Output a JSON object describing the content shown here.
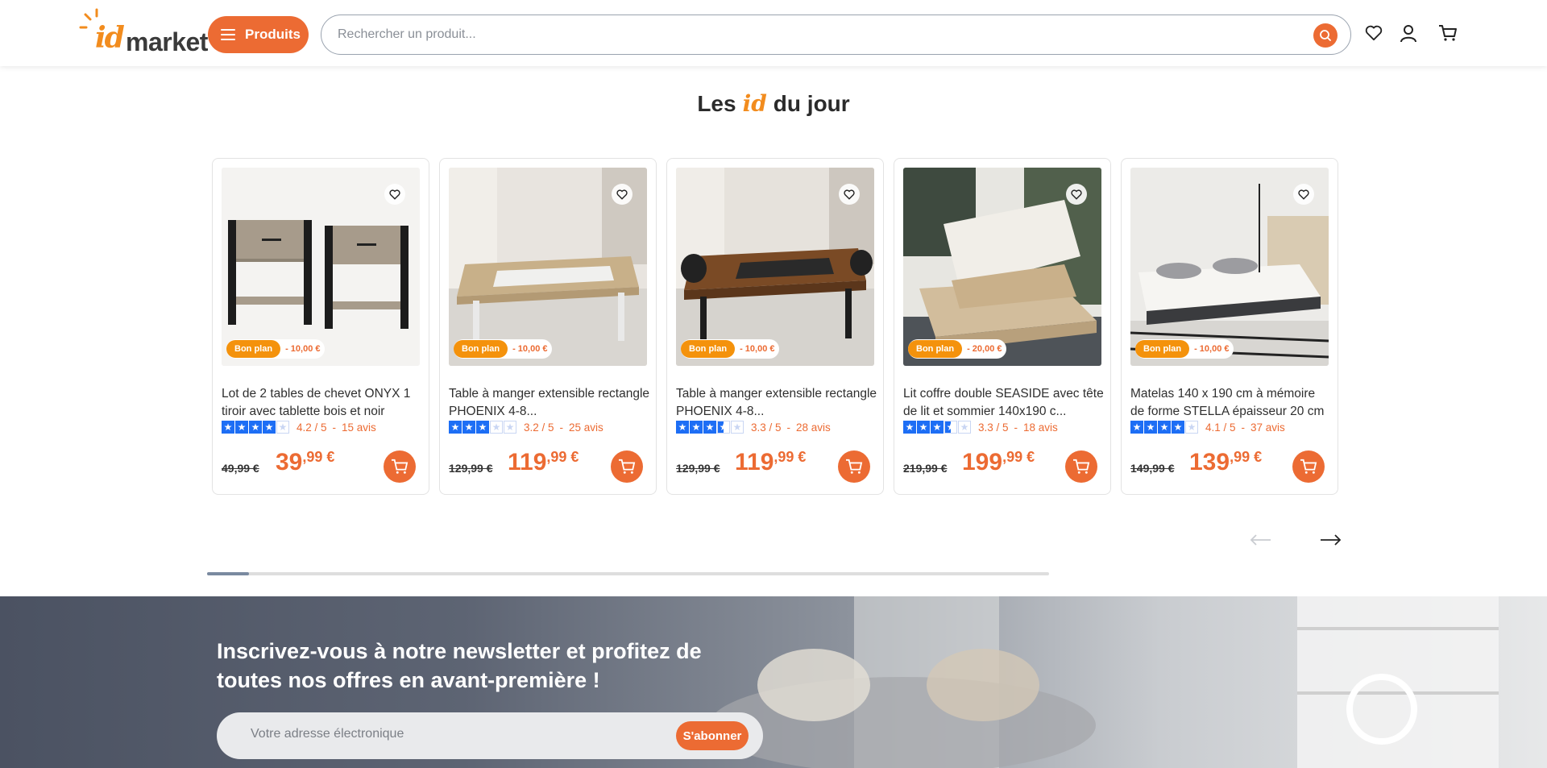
{
  "header": {
    "logo_text": "idmarket",
    "products_button": "Produits",
    "search_placeholder": "Rechercher un produit..."
  },
  "section": {
    "title_left": "Les",
    "title_id": "id",
    "title_right": "du jour"
  },
  "products": [
    {
      "name": "Lot de 2 tables de chevet ONYX 1 tiroir avec tablette bois et noir",
      "badge": "Bon plan",
      "discount": "- 10,00 €",
      "rating": 4.2,
      "rating_text": "4.2 / 5",
      "reviews": "15 avis",
      "old_price": "49,99 €",
      "price_int": "39",
      "price_dec": ",99 €"
    },
    {
      "name": "Table à manger extensible rectangle PHOENIX 4-8...",
      "badge": "Bon plan",
      "discount": "- 10,00 €",
      "rating": 3.2,
      "rating_text": "3.2 / 5",
      "reviews": "25 avis",
      "old_price": "129,99 €",
      "price_int": "119",
      "price_dec": ",99 €"
    },
    {
      "name": "Table à manger extensible rectangle PHOENIX 4-8...",
      "badge": "Bon plan",
      "discount": "- 10,00 €",
      "rating": 3.3,
      "rating_text": "3.3 / 5",
      "reviews": "28 avis",
      "old_price": "129,99 €",
      "price_int": "119",
      "price_dec": ",99 €"
    },
    {
      "name": "Lit coffre double SEASIDE avec tête de lit et sommier 140x190 c...",
      "badge": "Bon plan",
      "discount": "- 20,00 €",
      "rating": 3.3,
      "rating_text": "3.3 / 5",
      "reviews": "18 avis",
      "old_price": "219,99 €",
      "price_int": "199",
      "price_dec": ",99 €"
    },
    {
      "name": "Matelas 140 x 190 cm à mémoire de forme STELLA épaisseur 20 cm",
      "badge": "Bon plan",
      "discount": "- 10,00 €",
      "rating": 4.1,
      "rating_text": "4.1 / 5",
      "reviews": "37 avis",
      "old_price": "149,99 €",
      "price_int": "139",
      "price_dec": ",99 €"
    }
  ],
  "carousel": {
    "position_fraction": 0.05
  },
  "newsletter": {
    "title": "Inscrivez-vous à notre newsletter et profitez de toutes nos offres en avant-première !",
    "placeholder": "Votre adresse électronique",
    "button": "S'abonner"
  },
  "colors": {
    "accent": "#ec6b33",
    "badge": "#f4920c",
    "star": "#1d6ef5"
  }
}
